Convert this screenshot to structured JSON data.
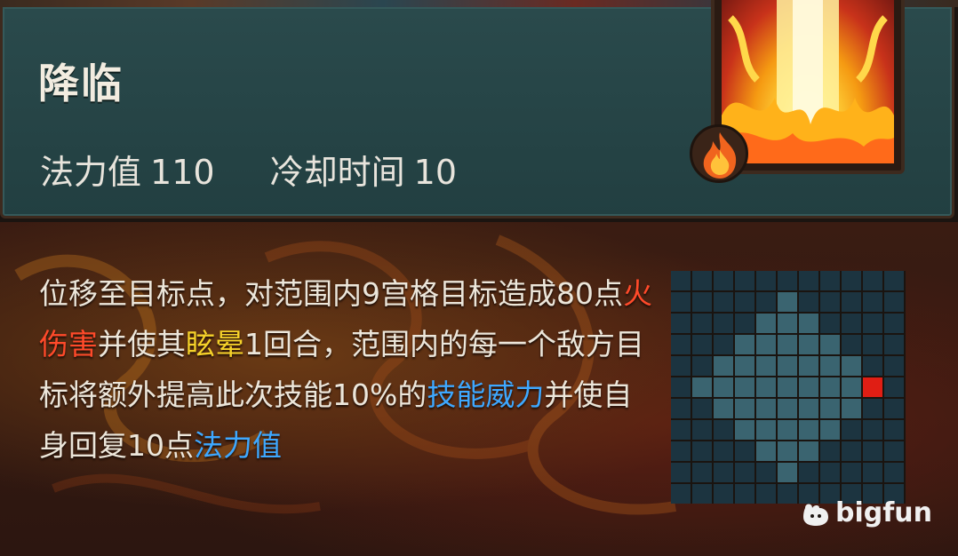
{
  "skill": {
    "name": "降临",
    "mana_label": "法力值",
    "mana_value": "110",
    "cooldown_label": "冷却时间",
    "cooldown_value": "10",
    "element_icon": "fire-icon"
  },
  "description": {
    "part1": "位移至目标点，对范围内9宫格目标造成80点",
    "fire_damage": "火伤害",
    "part2": "并使其",
    "stun": "眩晕",
    "part3": "1回合，范围内的每一个敌方目标将额外提高此次技能10%的",
    "skill_power": "技能威力",
    "part4": "并使自身回复10点",
    "mana": "法力值"
  },
  "range_grid": {
    "columns": 11,
    "rows": 11,
    "area_color": "#3a6470",
    "empty_color": "#1c3440",
    "target_color": "#e01e14",
    "area_cells": [
      [
        1,
        5
      ],
      [
        2,
        4
      ],
      [
        2,
        5
      ],
      [
        2,
        6
      ],
      [
        3,
        3
      ],
      [
        3,
        4
      ],
      [
        3,
        5
      ],
      [
        3,
        6
      ],
      [
        3,
        7
      ],
      [
        4,
        2
      ],
      [
        4,
        3
      ],
      [
        4,
        4
      ],
      [
        4,
        5
      ],
      [
        4,
        6
      ],
      [
        4,
        7
      ],
      [
        4,
        8
      ],
      [
        5,
        1
      ],
      [
        5,
        2
      ],
      [
        5,
        3
      ],
      [
        5,
        4
      ],
      [
        5,
        5
      ],
      [
        5,
        6
      ],
      [
        5,
        7
      ],
      [
        5,
        8
      ],
      [
        5,
        9
      ],
      [
        6,
        2
      ],
      [
        6,
        3
      ],
      [
        6,
        4
      ],
      [
        6,
        5
      ],
      [
        6,
        6
      ],
      [
        6,
        7
      ],
      [
        6,
        8
      ],
      [
        7,
        3
      ],
      [
        7,
        4
      ],
      [
        7,
        5
      ],
      [
        7,
        6
      ],
      [
        7,
        7
      ],
      [
        8,
        4
      ],
      [
        8,
        5
      ],
      [
        8,
        6
      ],
      [
        9,
        5
      ]
    ],
    "target_cell": [
      5,
      9
    ]
  },
  "watermark": {
    "text": "bigfun",
    "icon": "bigfun-logo-icon"
  },
  "colors": {
    "fire_text": "#ff4a2a",
    "stun_text": "#f5d22a",
    "blue_text": "#3ea8ff",
    "panel_bg": "#2a4a4c"
  }
}
